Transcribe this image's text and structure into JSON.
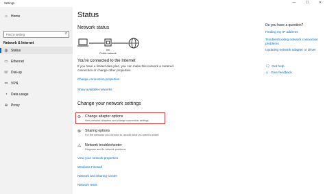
{
  "window": {
    "title": "Settings",
    "controls": [
      "—",
      "☐",
      "✕"
    ]
  },
  "sidebar": {
    "home": "Home",
    "search_placeholder": "Find a setting",
    "section": "Network & Internet",
    "items": [
      {
        "label": "Status",
        "icon": "globe-icon"
      },
      {
        "label": "Ethernet",
        "icon": "ethernet-icon"
      },
      {
        "label": "Dial-up",
        "icon": "phone-icon"
      },
      {
        "label": "VPN",
        "icon": "vpn-icon"
      },
      {
        "label": "Data usage",
        "icon": "data-usage-icon"
      },
      {
        "label": "Proxy",
        "icon": "proxy-icon"
      }
    ]
  },
  "main": {
    "title": "Status",
    "network_status_heading": "Network status",
    "diagram": {
      "label1": "nw",
      "label2": "Public network"
    },
    "connected_heading": "You're connected to the Internet",
    "connected_text": "If you have a limited data plan, you can make this network a metered connection or change other properties.",
    "change_connection": "Change connection properties",
    "show_networks": "Show available networks",
    "change_settings_heading": "Change your network settings",
    "options": [
      {
        "title": "Change adapter options",
        "desc": "View network adapters and change connection settings."
      },
      {
        "title": "Sharing options",
        "desc": "For the networks you connect to, decide what you want to share."
      },
      {
        "title": "Network troubleshooter",
        "desc": "Diagnose and fix network problems."
      }
    ],
    "links": [
      "View your network properties",
      "Windows Firewall",
      "Network and Sharing Centre",
      "Network reset"
    ]
  },
  "right": {
    "question": "Do you have a question?",
    "links": [
      "Finding my IP address",
      "Troubleshooting network connection problems",
      "Updating network adapter or driver"
    ],
    "get_help": "Get help",
    "give_feedback": "Give feedback"
  },
  "colors": {
    "accent": "#0067c0",
    "highlight": "#d9333a",
    "sidebar_bg": "#f2f2f2"
  }
}
